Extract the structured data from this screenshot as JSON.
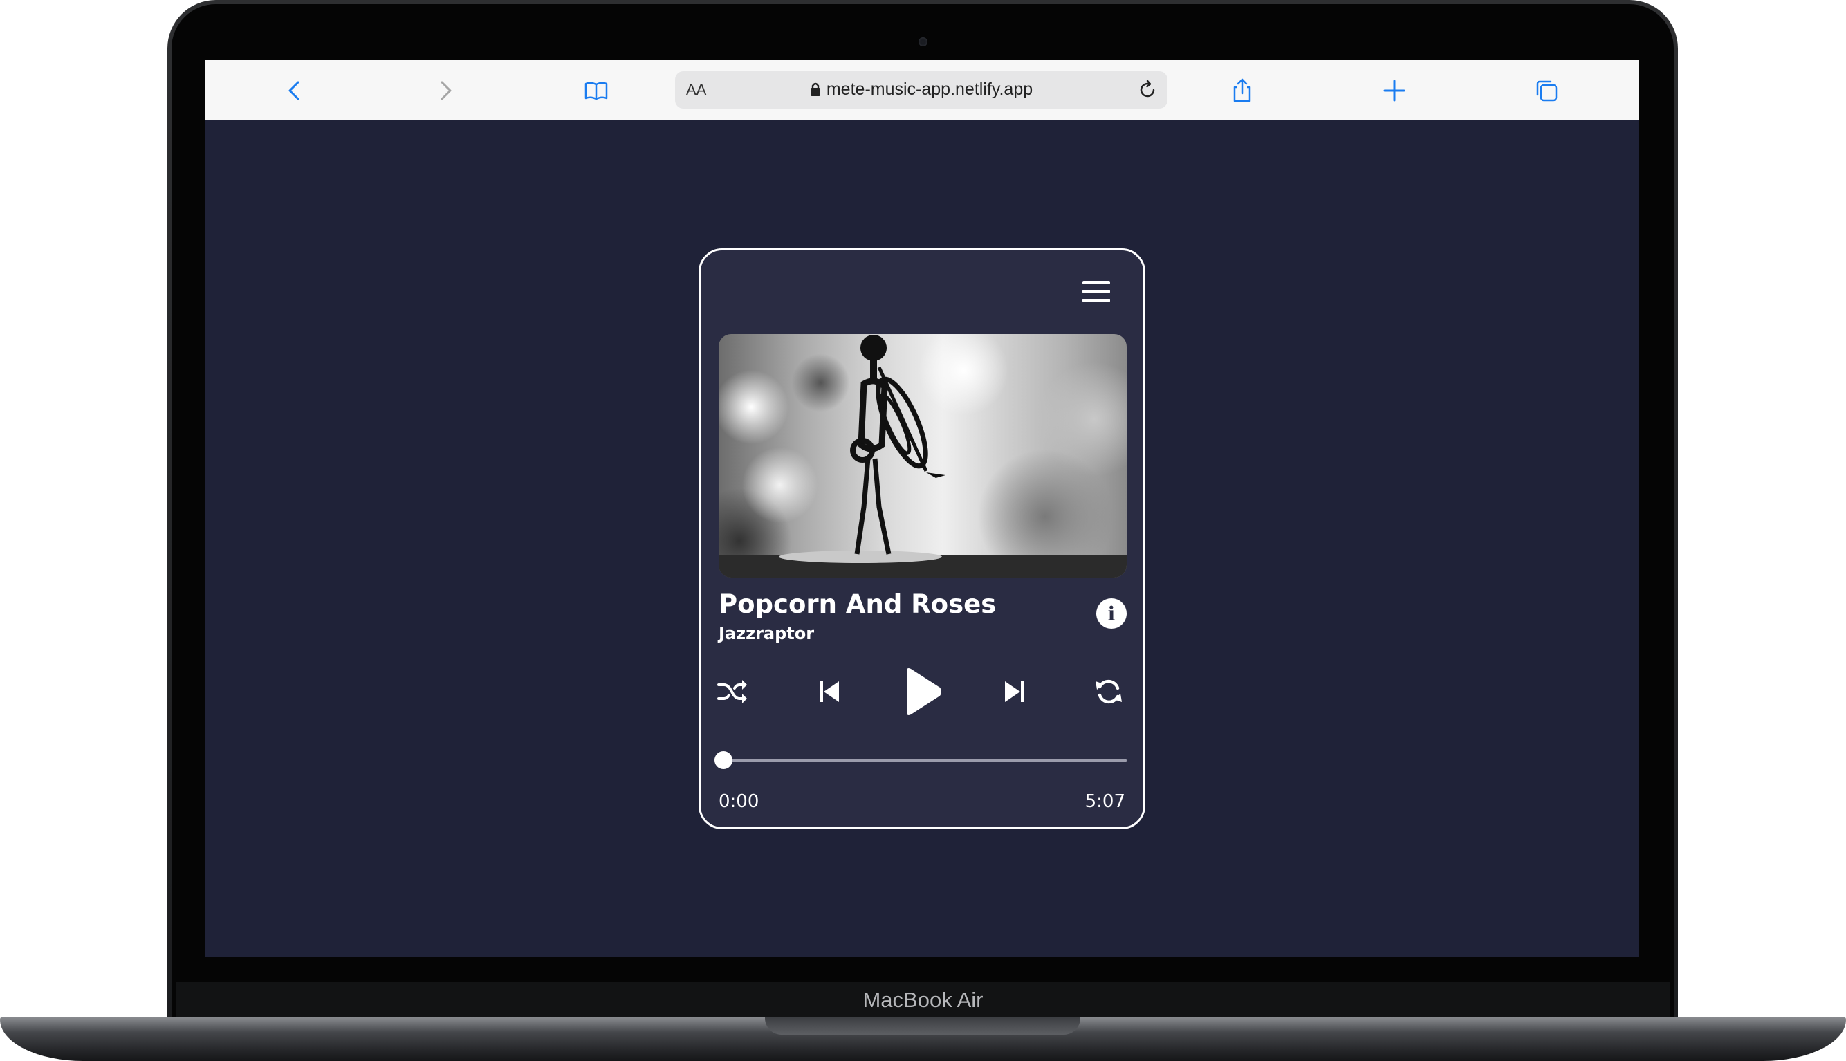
{
  "device": {
    "label": "MacBook Air"
  },
  "browser": {
    "address_prefix": "AA",
    "url": "mete-music-app.netlify.app",
    "accent_color": "#1a7cf0"
  },
  "player": {
    "song_title": "Popcorn And Roses",
    "artist": "Jazzraptor",
    "current_time": "0:00",
    "duration": "5:07",
    "progress_fraction": 0.0,
    "card_background": "#2a2c43",
    "page_background": "#1f2238"
  },
  "icons": {
    "menu": "menu-icon",
    "info": "info-icon",
    "shuffle": "shuffle-icon",
    "previous": "previous-track-icon",
    "play": "play-icon",
    "next": "next-track-icon",
    "repeat": "repeat-icon"
  }
}
